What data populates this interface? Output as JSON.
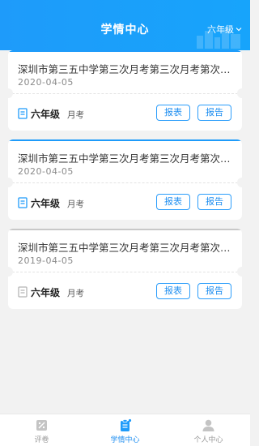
{
  "header": {
    "title": "学情中心",
    "grade_selector": "六年级"
  },
  "exams": [
    {
      "name": "深圳市第三五中学第三次月考第三次月考第次月考",
      "date": "2020-04-05",
      "grade": "六年级",
      "type": "月考",
      "status": "active"
    },
    {
      "name": "深圳市第三五中学第三次月考第三次月考第次月考",
      "date": "2020-04-05",
      "grade": "六年级",
      "type": "月考",
      "status": "active"
    },
    {
      "name": "深圳市第三五中学第三次月考第三次月考第次月考",
      "date": "2019-04-05",
      "grade": "六年级",
      "type": "月考",
      "status": "inactive"
    }
  ],
  "buttons": {
    "report_table": "报表",
    "report": "报告"
  },
  "tabbar": {
    "items": [
      {
        "label": "评卷",
        "icon": "grading-icon",
        "active": false
      },
      {
        "label": "学情中心",
        "icon": "clipboard-icon",
        "active": true
      },
      {
        "label": "个人中心",
        "icon": "person-icon",
        "active": false
      }
    ]
  },
  "colors": {
    "primary": "#1e9bfa",
    "inactive_line": "#c8c8c8",
    "background": "#f2f2f2"
  }
}
